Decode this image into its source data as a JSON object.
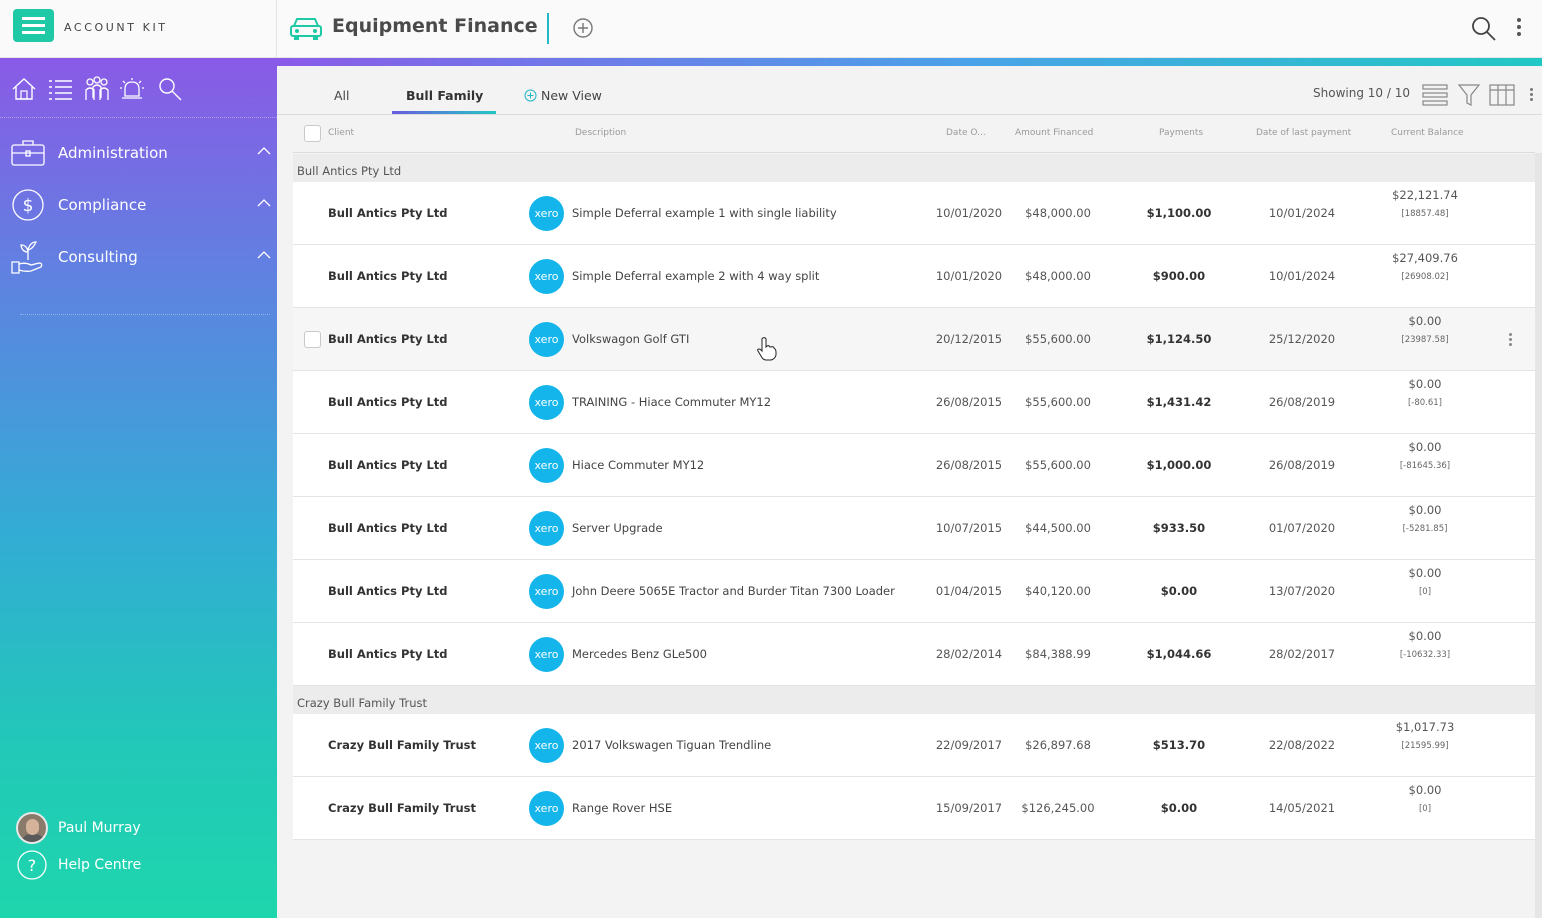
{
  "app": {
    "logo_text": "ACCOUNT KIT",
    "page_title": "Equipment Finance"
  },
  "sidebar": {
    "icons": [
      "home-icon",
      "list-icon",
      "people-icon",
      "alarm-icon",
      "search-icon"
    ],
    "nav": [
      {
        "label": "Administration",
        "icon": "briefcase-icon"
      },
      {
        "label": "Compliance",
        "icon": "dollar-icon"
      },
      {
        "label": "Consulting",
        "icon": "hand-plant-icon"
      }
    ],
    "user_name": "Paul Murray",
    "help_label": "Help Centre"
  },
  "tabs": {
    "all": "All",
    "bull_family": "Bull Family",
    "new_view": "New View"
  },
  "toolbar": {
    "showing": "Showing 10 / 10"
  },
  "columns": {
    "client": "Client",
    "description": "Description",
    "date": "Date O...",
    "amount": "Amount Financed",
    "payments": "Payments",
    "last_payment": "Date of last payment",
    "balance": "Current Balance"
  },
  "badge_label": "xero",
  "groups": [
    {
      "name": "Bull Antics Pty Ltd",
      "rows": [
        {
          "client": "Bull Antics Pty Ltd",
          "description": "Simple Deferral example 1 with single liability",
          "date": "10/01/2020",
          "amount": "$48,000.00",
          "payments": "$1,100.00",
          "last_payment": "10/01/2024",
          "balance": "$22,121.74",
          "balance_sub": "[18857.48]"
        },
        {
          "client": "Bull Antics Pty Ltd",
          "description": "Simple Deferral example 2 with 4 way split",
          "date": "10/01/2020",
          "amount": "$48,000.00",
          "payments": "$900.00",
          "last_payment": "10/01/2024",
          "balance": "$27,409.76",
          "balance_sub": "[26908.02]"
        },
        {
          "client": "Bull Antics Pty Ltd",
          "description": "Volkswagon Golf GTI",
          "date": "20/12/2015",
          "amount": "$55,600.00",
          "payments": "$1,124.50",
          "last_payment": "25/12/2020",
          "balance": "$0.00",
          "balance_sub": "[23987.58]"
        },
        {
          "client": "Bull Antics Pty Ltd",
          "description": "TRAINING - Hiace Commuter MY12",
          "date": "26/08/2015",
          "amount": "$55,600.00",
          "payments": "$1,431.42",
          "last_payment": "26/08/2019",
          "balance": "$0.00",
          "balance_sub": "[-80.61]"
        },
        {
          "client": "Bull Antics Pty Ltd",
          "description": "Hiace Commuter MY12",
          "date": "26/08/2015",
          "amount": "$55,600.00",
          "payments": "$1,000.00",
          "last_payment": "26/08/2019",
          "balance": "$0.00",
          "balance_sub": "[-81645.36]"
        },
        {
          "client": "Bull Antics Pty Ltd",
          "description": "Server Upgrade",
          "date": "10/07/2015",
          "amount": "$44,500.00",
          "payments": "$933.50",
          "last_payment": "01/07/2020",
          "balance": "$0.00",
          "balance_sub": "[-5281.85]"
        },
        {
          "client": "Bull Antics Pty Ltd",
          "description": "John Deere 5065E Tractor and Burder Titan 7300 Loader",
          "date": "01/04/2015",
          "amount": "$40,120.00",
          "payments": "$0.00",
          "last_payment": "13/07/2020",
          "balance": "$0.00",
          "balance_sub": "[0]"
        },
        {
          "client": "Bull Antics Pty Ltd",
          "description": "Mercedes Benz GLe500",
          "date": "28/02/2014",
          "amount": "$84,388.99",
          "payments": "$1,044.66",
          "last_payment": "28/02/2017",
          "balance": "$0.00",
          "balance_sub": "[-10632.33]"
        }
      ]
    },
    {
      "name": "Crazy Bull Family Trust",
      "rows": [
        {
          "client": "Crazy Bull Family Trust",
          "description": "2017 Volkswagen Tiguan Trendline",
          "date": "22/09/2017",
          "amount": "$26,897.68",
          "payments": "$513.70",
          "last_payment": "22/08/2022",
          "balance": "$1,017.73",
          "balance_sub": "[21595.99]"
        },
        {
          "client": "Crazy Bull Family Trust",
          "description": "Range Rover HSE",
          "date": "15/09/2017",
          "amount": "$126,245.00",
          "payments": "$0.00",
          "last_payment": "14/05/2021",
          "balance": "$0.00",
          "balance_sub": "[0]"
        }
      ]
    }
  ],
  "colors": {
    "accent": "#1fc9a6",
    "xero": "#13b5ea",
    "sidebar_top": "#8a5ae6",
    "sidebar_bottom": "#1ed6ad"
  }
}
